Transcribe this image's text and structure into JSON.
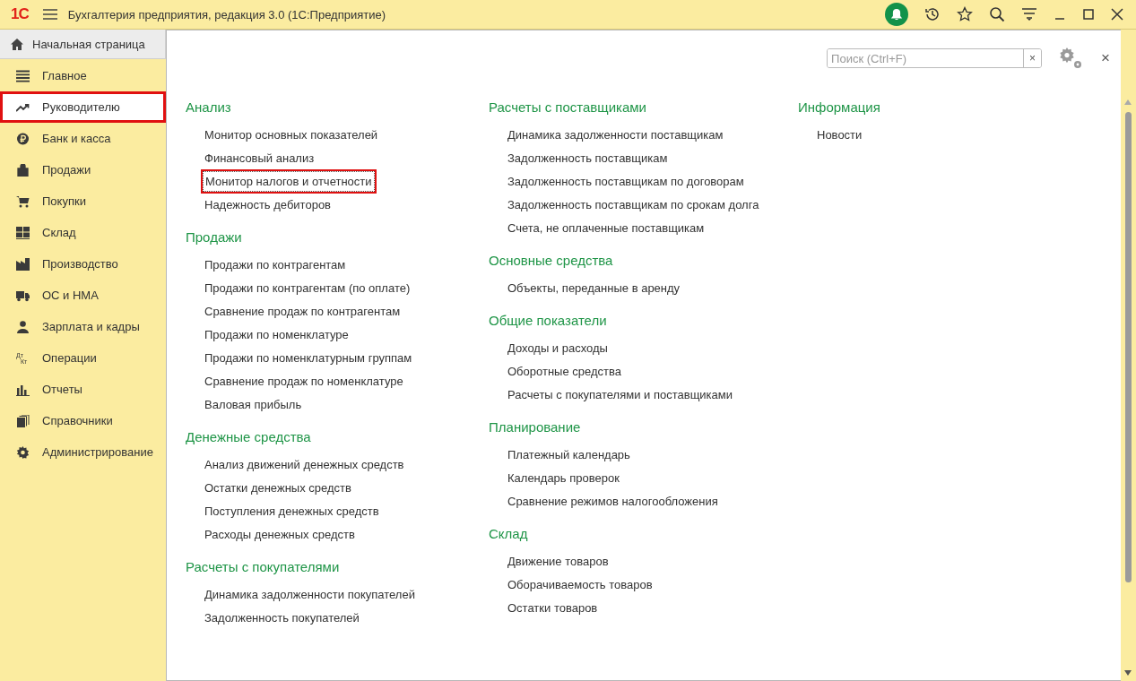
{
  "window": {
    "logo": "1С",
    "title": "Бухгалтерия предприятия, редакция 3.0  (1С:Предприятие)"
  },
  "home_tab": {
    "label": "Начальная страница"
  },
  "sidebar": {
    "items": [
      {
        "label": "Главное",
        "kind": "list",
        "selected": false
      },
      {
        "label": "Руководителю",
        "kind": "trend",
        "selected": true
      },
      {
        "label": "Банк и касса",
        "kind": "ruble",
        "selected": false
      },
      {
        "label": "Продажи",
        "kind": "bag",
        "selected": false
      },
      {
        "label": "Покупки",
        "kind": "cart",
        "selected": false
      },
      {
        "label": "Склад",
        "kind": "grid",
        "selected": false
      },
      {
        "label": "Производство",
        "kind": "factory",
        "selected": false
      },
      {
        "label": "ОС и НМА",
        "kind": "truck",
        "selected": false
      },
      {
        "label": "Зарплата и кадры",
        "kind": "person",
        "selected": false
      },
      {
        "label": "Операции",
        "kind": "dtkt",
        "icon_text": [
          "Дт",
          "Кт"
        ],
        "selected": false
      },
      {
        "label": "Отчеты",
        "kind": "bars",
        "selected": false
      },
      {
        "label": "Справочники",
        "kind": "books",
        "selected": false
      },
      {
        "label": "Администрирование",
        "kind": "gear",
        "selected": false
      }
    ]
  },
  "search": {
    "placeholder": "Поиск (Ctrl+F)",
    "clear": "×"
  },
  "close_panel": "×",
  "columns": [
    [
      {
        "title": "Анализ",
        "items": [
          {
            "label": "Монитор основных показателей",
            "highlighted": false
          },
          {
            "label": "Финансовый анализ",
            "highlighted": false
          },
          {
            "label": "Монитор налогов и отчетности",
            "highlighted": true
          },
          {
            "label": "Надежность дебиторов",
            "highlighted": false
          }
        ]
      },
      {
        "title": "Продажи",
        "items": [
          {
            "label": "Продажи по контрагентам",
            "highlighted": false
          },
          {
            "label": "Продажи по контрагентам (по оплате)",
            "highlighted": false
          },
          {
            "label": "Сравнение продаж по контрагентам",
            "highlighted": false
          },
          {
            "label": "Продажи по номенклатуре",
            "highlighted": false
          },
          {
            "label": "Продажи по номенклатурным группам",
            "highlighted": false
          },
          {
            "label": "Сравнение продаж по номенклатуре",
            "highlighted": false
          },
          {
            "label": "Валовая прибыль",
            "highlighted": false
          }
        ]
      },
      {
        "title": "Денежные средства",
        "items": [
          {
            "label": "Анализ движений денежных средств",
            "highlighted": false
          },
          {
            "label": "Остатки денежных средств",
            "highlighted": false
          },
          {
            "label": "Поступления денежных средств",
            "highlighted": false
          },
          {
            "label": "Расходы денежных средств",
            "highlighted": false
          }
        ]
      },
      {
        "title": "Расчеты с покупателями",
        "items": [
          {
            "label": "Динамика задолженности покупателей",
            "highlighted": false
          },
          {
            "label": "Задолженность покупателей",
            "highlighted": false
          }
        ]
      }
    ],
    [
      {
        "title": "Расчеты с поставщиками",
        "items": [
          {
            "label": "Динамика задолженности поставщикам",
            "highlighted": false
          },
          {
            "label": "Задолженность поставщикам",
            "highlighted": false
          },
          {
            "label": "Задолженность поставщикам по договорам",
            "highlighted": false
          },
          {
            "label": "Задолженность поставщикам по срокам долга",
            "highlighted": false
          },
          {
            "label": "Счета, не оплаченные поставщикам",
            "highlighted": false
          }
        ]
      },
      {
        "title": "Основные средства",
        "items": [
          {
            "label": "Объекты, переданные в аренду",
            "highlighted": false
          }
        ]
      },
      {
        "title": "Общие показатели",
        "items": [
          {
            "label": "Доходы и расходы",
            "highlighted": false
          },
          {
            "label": "Оборотные средства",
            "highlighted": false
          },
          {
            "label": "Расчеты с покупателями и поставщиками",
            "highlighted": false
          }
        ]
      },
      {
        "title": "Планирование",
        "items": [
          {
            "label": "Платежный календарь",
            "highlighted": false
          },
          {
            "label": "Календарь проверок",
            "highlighted": false
          },
          {
            "label": "Сравнение режимов налогообложения",
            "highlighted": false
          }
        ]
      },
      {
        "title": "Склад",
        "items": [
          {
            "label": "Движение товаров",
            "highlighted": false
          },
          {
            "label": "Оборачиваемость товаров",
            "highlighted": false
          },
          {
            "label": "Остатки товаров",
            "highlighted": false
          }
        ]
      }
    ],
    [
      {
        "title": "Информация",
        "items": [
          {
            "label": "Новости",
            "highlighted": false
          }
        ]
      }
    ]
  ]
}
